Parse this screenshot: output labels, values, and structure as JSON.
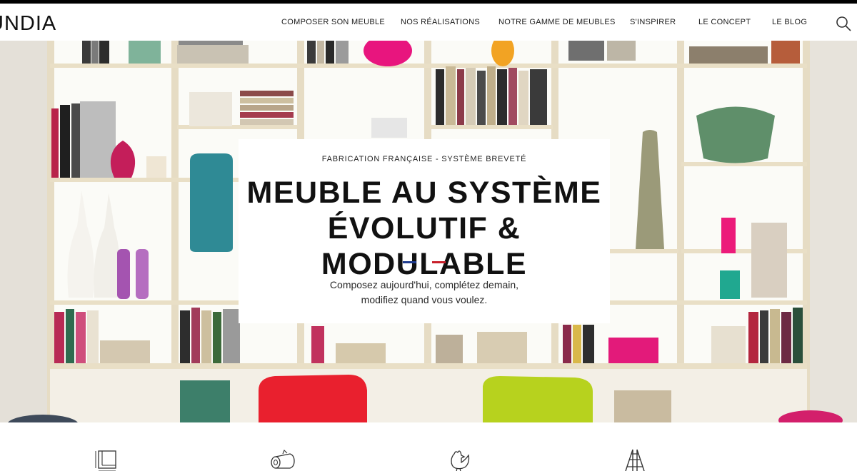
{
  "header": {
    "logo": "UNDIA",
    "nav": [
      "COMPOSER SON MEUBLE",
      "NOS RÉALISATIONS",
      "NOTRE GAMME DE MEUBLES",
      "S'INSPIRER",
      "LE CONCEPT",
      "LE BLOG"
    ]
  },
  "hero": {
    "kicker": "FABRICATION FRANÇAISE - SYSTÈME BREVETÉ",
    "title_line1": "MEUBLE AU SYSTÈME",
    "title_line2": "ÉVOLUTIF & MODULABLE",
    "subtitle_line1": "Composez aujourd'hui, complétez demain,",
    "subtitle_line2": "modifiez quand vous voulez."
  },
  "features": {
    "icons": [
      "dimensions-icon",
      "wood-log-icon",
      "rooster-icon",
      "ladder-shelf-icon"
    ]
  },
  "colors": {
    "flag_blue": "#1f3c8f",
    "flag_red": "#c8202b",
    "text": "#111111"
  }
}
